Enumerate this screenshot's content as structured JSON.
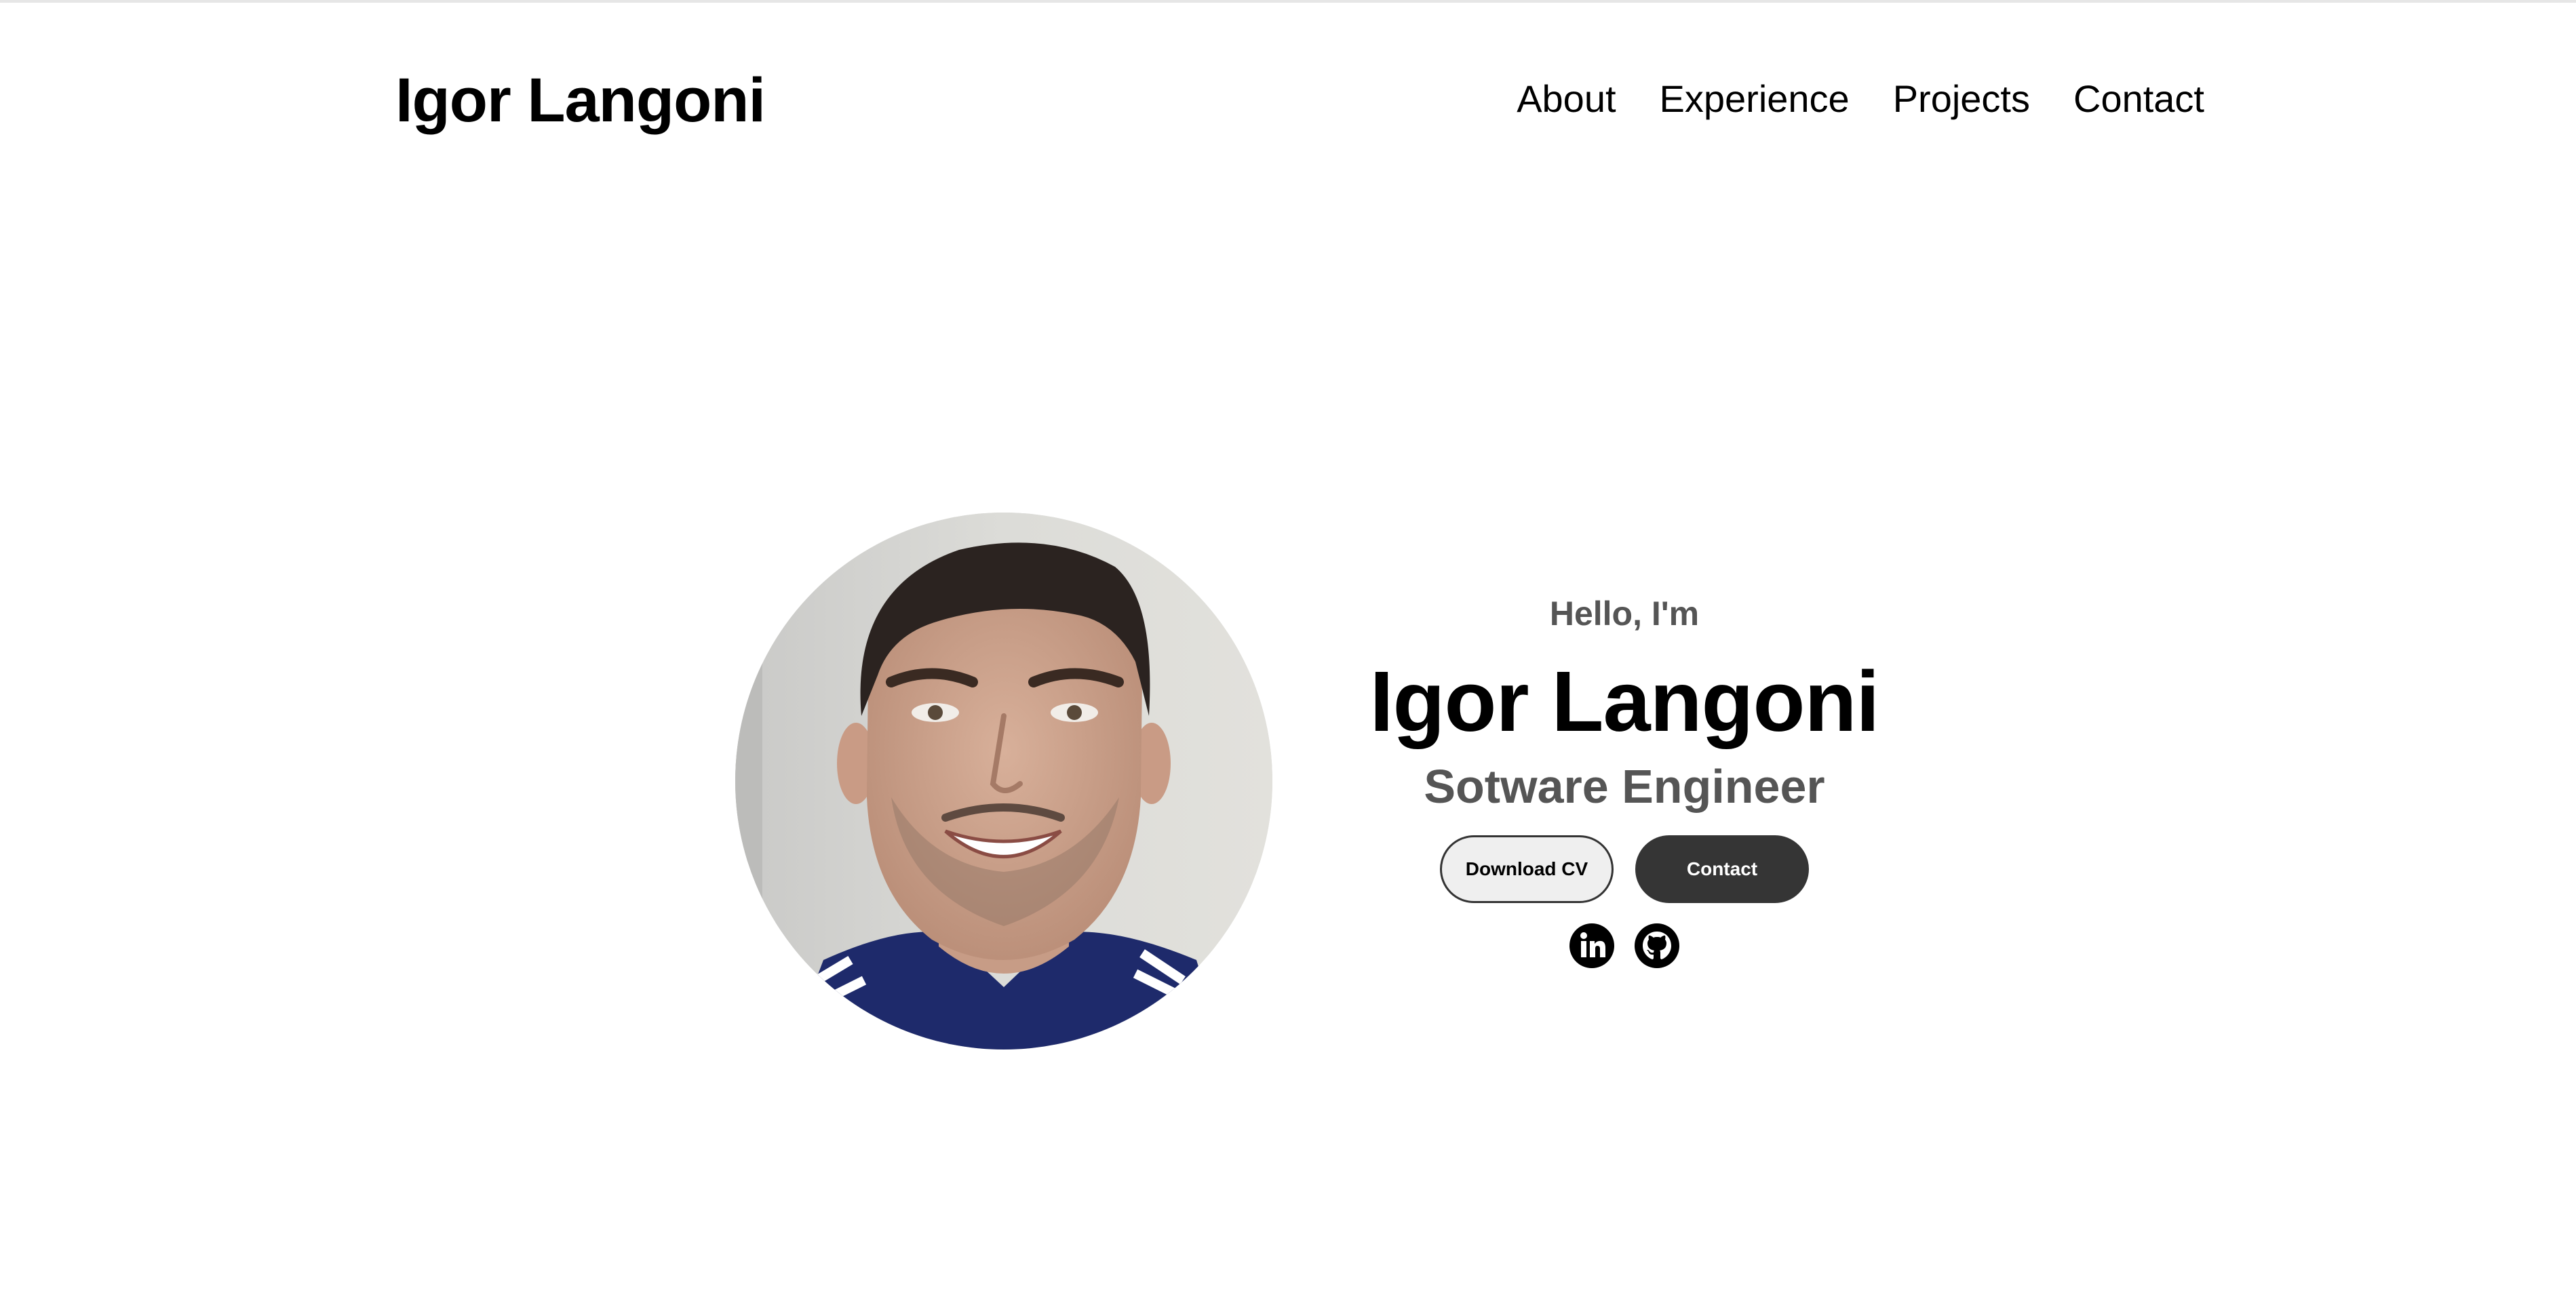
{
  "header": {
    "logo": "Igor Langoni",
    "nav": [
      "About",
      "Experience",
      "Projects",
      "Contact"
    ]
  },
  "hero": {
    "greeting": "Hello, I'm",
    "name": "Igor Langoni",
    "title": "Sotware Engineer",
    "buttons": {
      "download_cv": "Download CV",
      "contact": "Contact"
    },
    "socials": [
      "linkedin-icon",
      "github-icon"
    ]
  },
  "colors": {
    "text": "#000000",
    "muted": "#555555",
    "button_dark": "#353535",
    "button_light": "#efefef"
  }
}
